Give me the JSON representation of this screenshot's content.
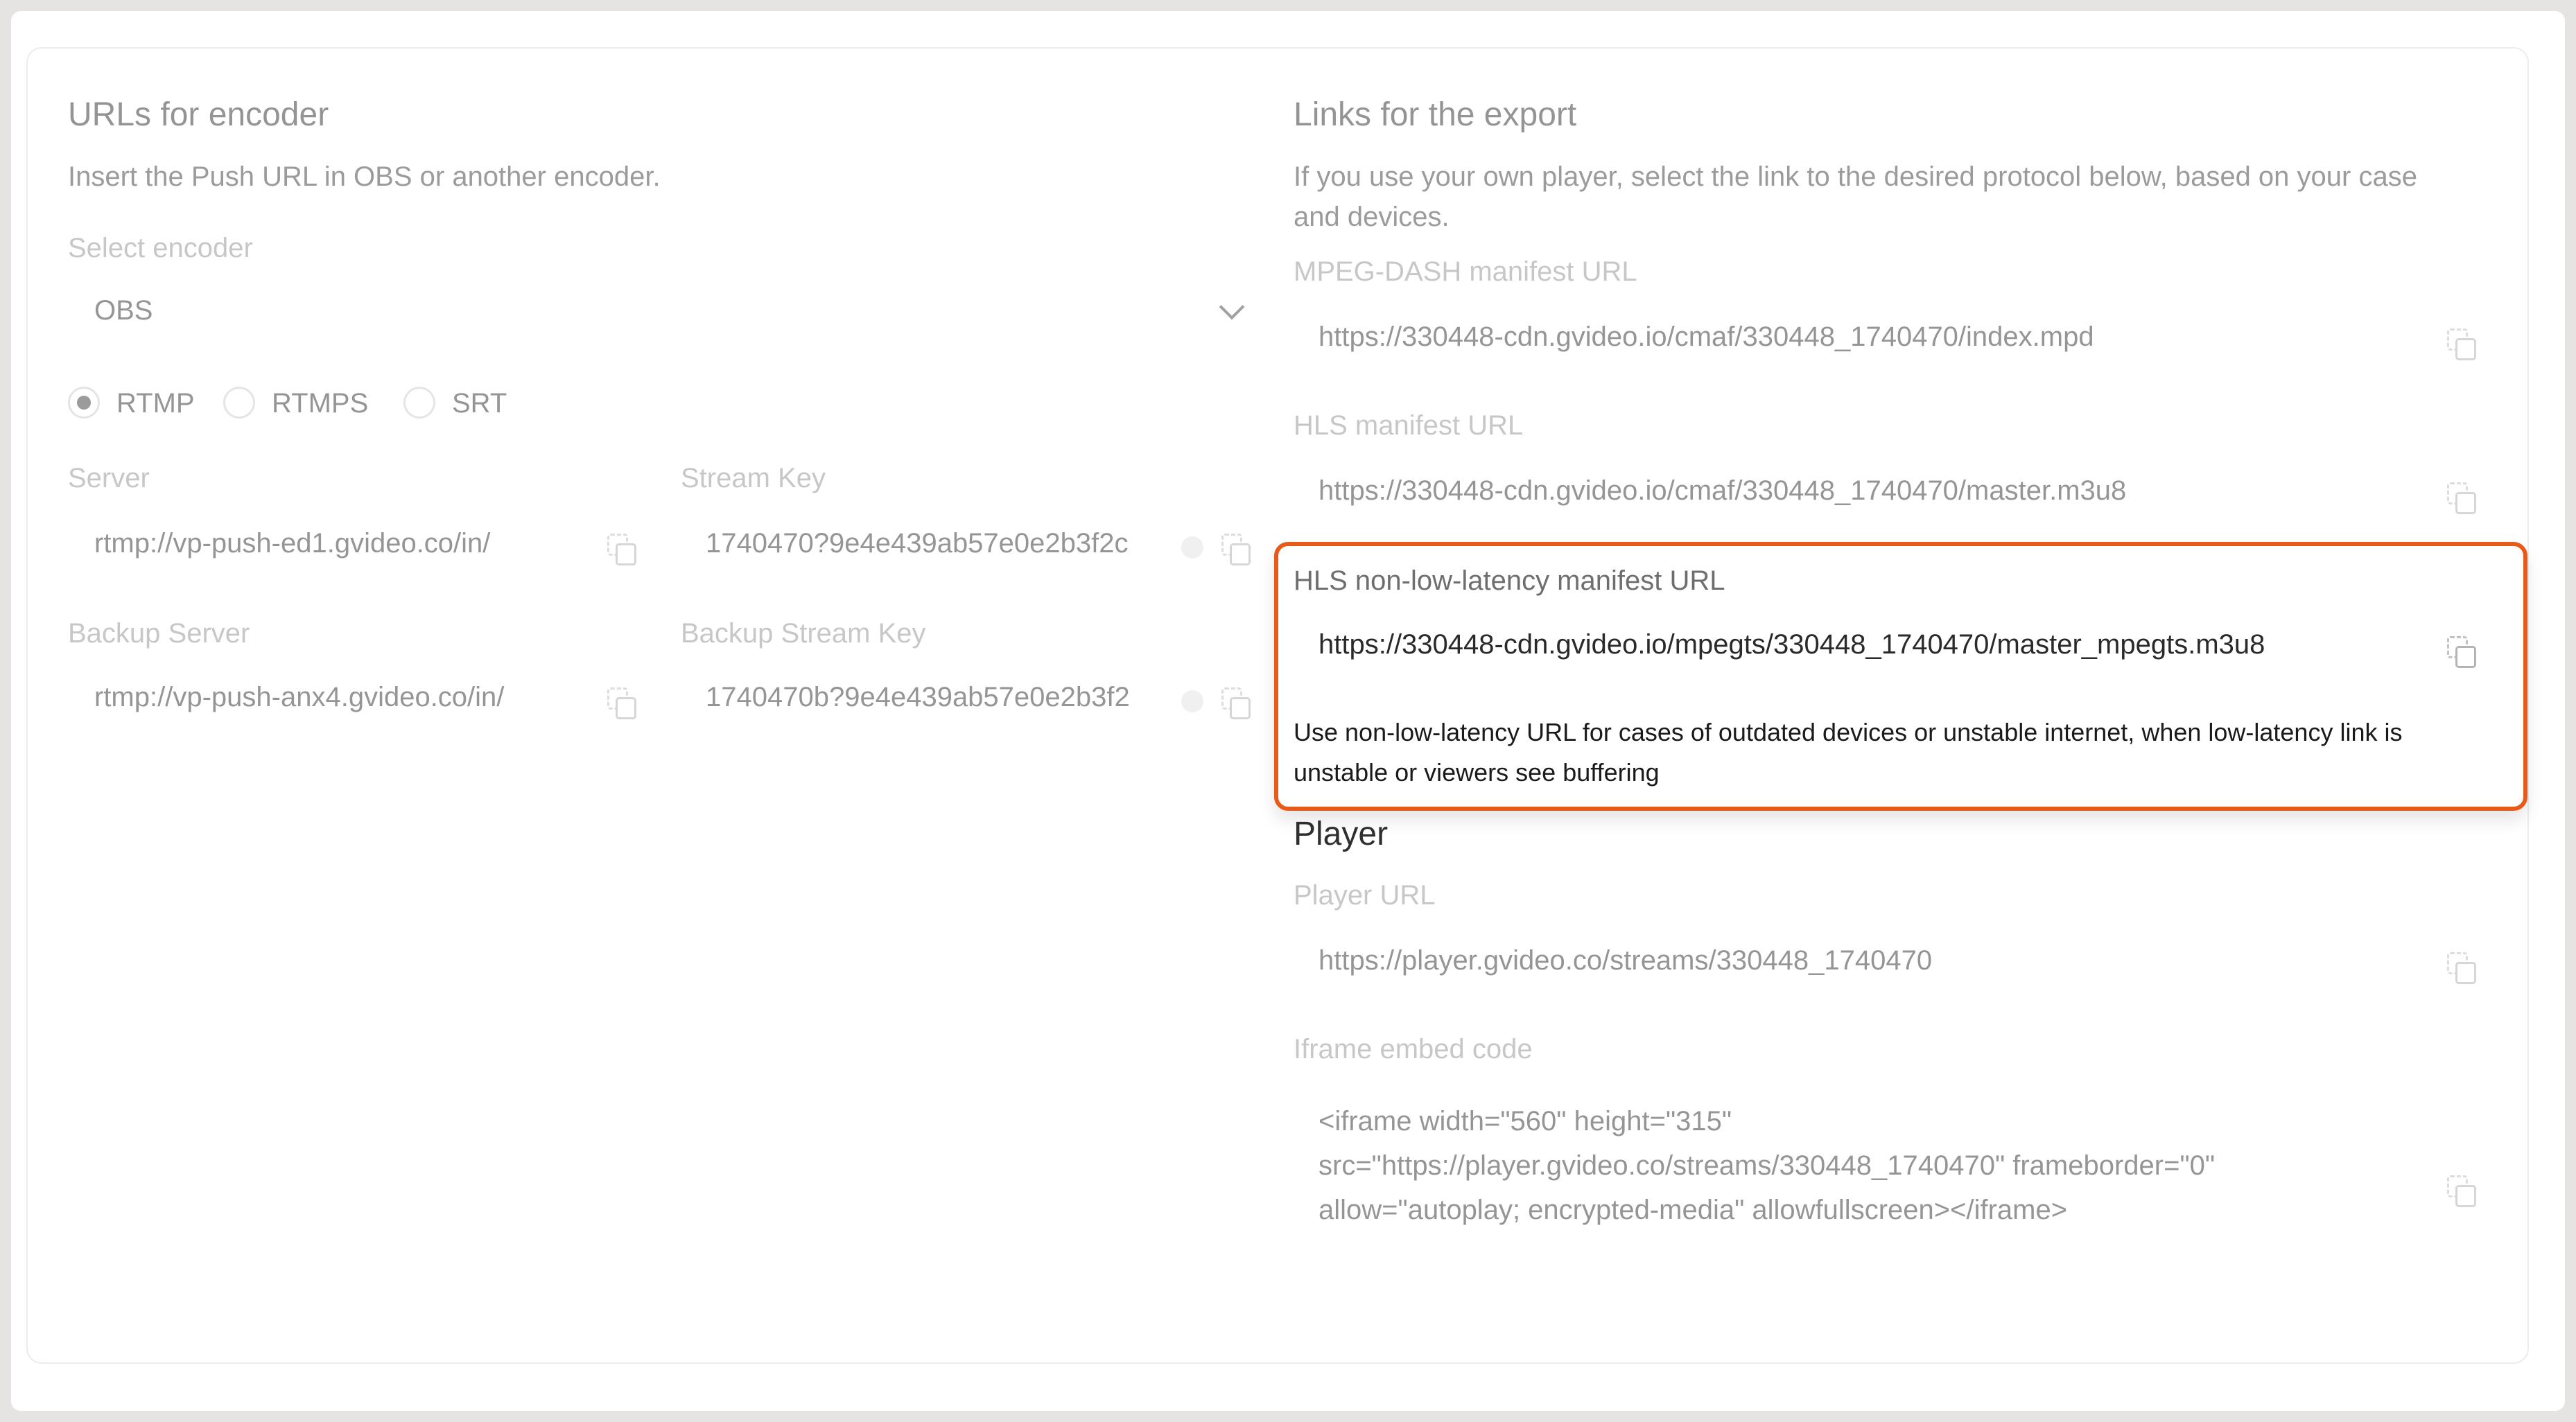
{
  "encoder": {
    "title": "URLs for encoder",
    "description": "Insert the Push URL in OBS or another encoder.",
    "select_label": "Select encoder",
    "select_value": "OBS",
    "protocols": [
      {
        "label": "RTMP",
        "selected": true
      },
      {
        "label": "RTMPS",
        "selected": false
      },
      {
        "label": "SRT",
        "selected": false
      }
    ],
    "server_label": "Server",
    "server_value": "rtmp://vp-push-ed1.gvideo.co/in/",
    "stream_key_label": "Stream Key",
    "stream_key_value": "1740470?9e4e439ab57e0e2b3f2c",
    "backup_server_label": "Backup Server",
    "backup_server_value": "rtmp://vp-push-anx4.gvideo.co/in/",
    "backup_key_label": "Backup Stream Key",
    "backup_key_value": "1740470b?9e4e439ab57e0e2b3f2"
  },
  "export": {
    "title": "Links for the export",
    "description": "If you use your own player, select the link to the desired protocol below, based on your case and devices.",
    "dash_label": "MPEG-DASH manifest URL",
    "dash_value": "https://330448-cdn.gvideo.io/cmaf/330448_1740470/index.mpd",
    "hls_label": "HLS manifest URL",
    "hls_value": "https://330448-cdn.gvideo.io/cmaf/330448_1740470/master.m3u8",
    "hls_nll_label": "HLS non-low-latency manifest URL",
    "hls_nll_value": "https://330448-cdn.gvideo.io/mpegts/330448_1740470/master_mpegts.m3u8",
    "hls_nll_note": "Use non-low-latency URL for cases of outdated devices or unstable internet, when low-latency link is unstable or viewers see buffering"
  },
  "player": {
    "title": "Player",
    "url_label": "Player URL",
    "url_value": "https://player.gvideo.co/streams/330448_1740470",
    "iframe_label": "Iframe embed code",
    "iframe_lines": [
      "<iframe width=\"560\" height=\"315\"",
      "src=\"https://player.gvideo.co/streams/330448_1740470\" frameborder=\"0\"",
      "allow=\"autoplay; encrypted-media\" allowfullscreen></iframe>"
    ]
  },
  "colors": {
    "highlight_border": "#e85a17",
    "background": "#e6e3e3"
  }
}
